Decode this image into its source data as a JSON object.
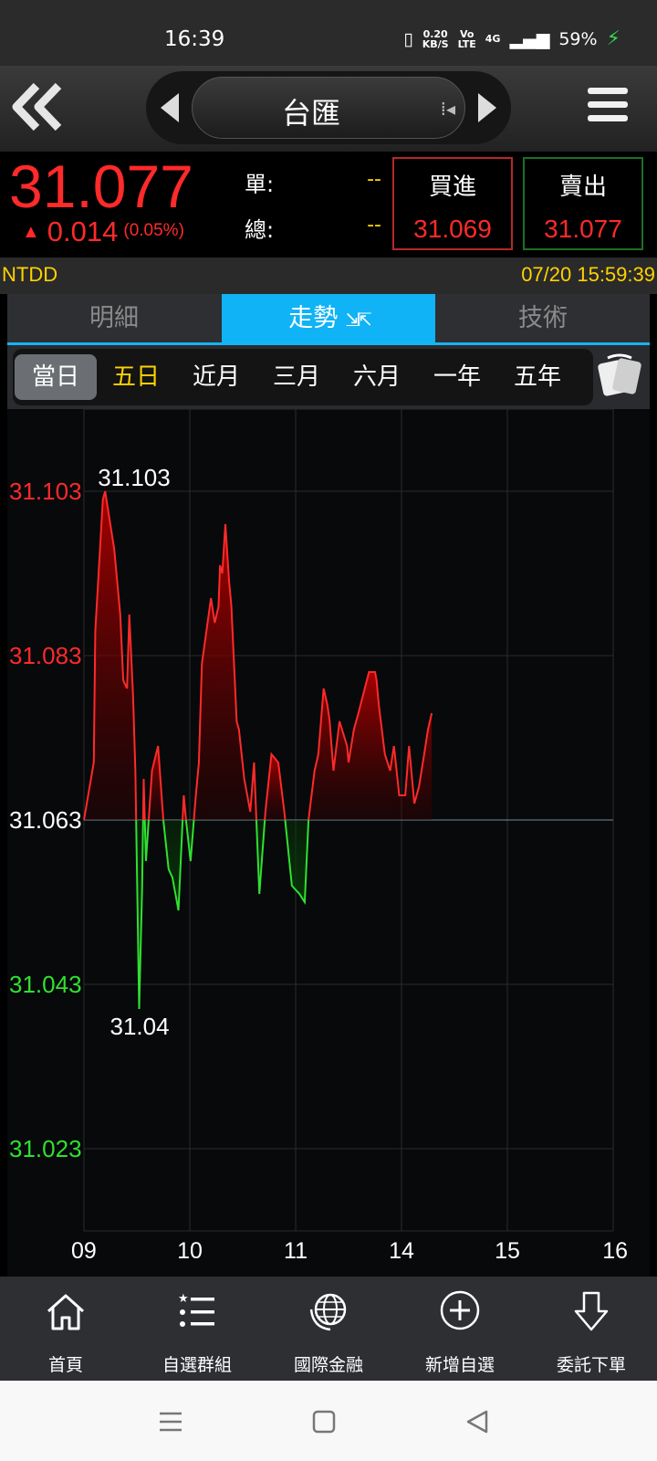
{
  "status_bar": {
    "time": "16:39",
    "net_speed_value": "0.20",
    "net_speed_unit": "KB/S",
    "volte_top": "Vo",
    "volte_bottom": "LTE",
    "signal": "4G",
    "battery": "59%"
  },
  "header": {
    "title": "台匯"
  },
  "quote": {
    "price": "31.077",
    "change": "0.014",
    "change_pct": "(0.05%)",
    "single_label": "單:",
    "single_value": "--",
    "total_label": "總:",
    "total_value": "--",
    "buy_label": "買進",
    "buy_value": "31.069",
    "sell_label": "賣出",
    "sell_value": "31.077",
    "up_color": "#ff2a2a"
  },
  "info": {
    "symbol": "NTDD",
    "datetime": "07/20 15:59:39"
  },
  "main_tabs": [
    "明細",
    "走勢",
    "技術"
  ],
  "period_tabs": [
    "當日",
    "五日",
    "近月",
    "三月",
    "六月",
    "一年",
    "五年"
  ],
  "chart_data": {
    "type": "area",
    "reference": 31.063,
    "ylim": [
      31.013,
      31.113
    ],
    "yticks": [
      "31.103",
      "31.083",
      "31.063",
      "31.043",
      "31.023"
    ],
    "xticks": [
      "09",
      "10",
      "11",
      "14",
      "15",
      "16"
    ],
    "xlim": [
      9,
      16
    ],
    "max_label": "31.103",
    "min_label": "31.04",
    "up_color": "#ff2a2a",
    "down_color": "#30e030",
    "x": [
      9.0,
      9.13,
      9.15,
      9.25,
      9.28,
      9.4,
      9.48,
      9.52,
      9.57,
      9.6,
      9.65,
      9.68,
      9.73,
      9.77,
      9.79,
      9.82,
      9.9,
      9.98,
      10.05,
      10.12,
      10.17,
      10.25,
      10.32,
      10.35,
      10.41,
      10.48,
      10.52,
      10.56,
      10.68,
      10.73,
      10.78,
      10.8,
      10.83,
      10.87,
      10.92,
      10.95,
      11.02,
      11.05,
      11.12,
      11.2,
      11.25,
      11.32,
      11.4,
      11.48,
      11.57,
      11.65,
      11.75,
      11.85,
      11.92,
      11.97,
      12.05,
      12.1,
      12.17,
      12.22,
      12.25,
      12.3,
      12.38,
      12.48,
      12.5,
      12.57,
      12.63,
      12.77,
      12.85,
      12.87,
      12.9,
      12.98,
      13.05,
      13.1,
      13.17,
      13.25,
      13.3,
      13.37,
      13.43,
      13.5,
      13.55,
      13.6
    ],
    "y": [
      31.063,
      31.07,
      31.086,
      31.102,
      31.103,
      31.096,
      31.088,
      31.08,
      31.079,
      31.088,
      31.078,
      31.069,
      31.04,
      31.055,
      31.068,
      31.058,
      31.069,
      31.072,
      31.063,
      31.057,
      31.056,
      31.052,
      31.066,
      31.063,
      31.058,
      31.066,
      31.07,
      31.082,
      31.09,
      31.087,
      31.089,
      31.094,
      31.093,
      31.099,
      31.092,
      31.089,
      31.075,
      31.074,
      31.068,
      31.064,
      31.07,
      31.054,
      31.064,
      31.071,
      31.07,
      31.064,
      31.055,
      31.054,
      31.053,
      31.063,
      31.069,
      31.071,
      31.079,
      31.077,
      31.075,
      31.069,
      31.075,
      31.072,
      31.07,
      31.074,
      31.076,
      31.081,
      31.081,
      31.08,
      31.077,
      31.071,
      31.069,
      31.072,
      31.066,
      31.066,
      31.072,
      31.065,
      31.067,
      31.071,
      31.074,
      31.076
    ]
  },
  "bottom_nav": [
    "首頁",
    "自選群組",
    "國際金融",
    "新增自選",
    "委託下單"
  ],
  "icons": {
    "back": "double-chevron-left-icon",
    "menu": "hamburger-menu-icon",
    "rotate": "rotate-screen-icon",
    "home": "home-icon",
    "list": "star-list-icon",
    "globe": "globe-icon",
    "add": "plus-circle-icon",
    "order": "arrow-down-icon"
  }
}
